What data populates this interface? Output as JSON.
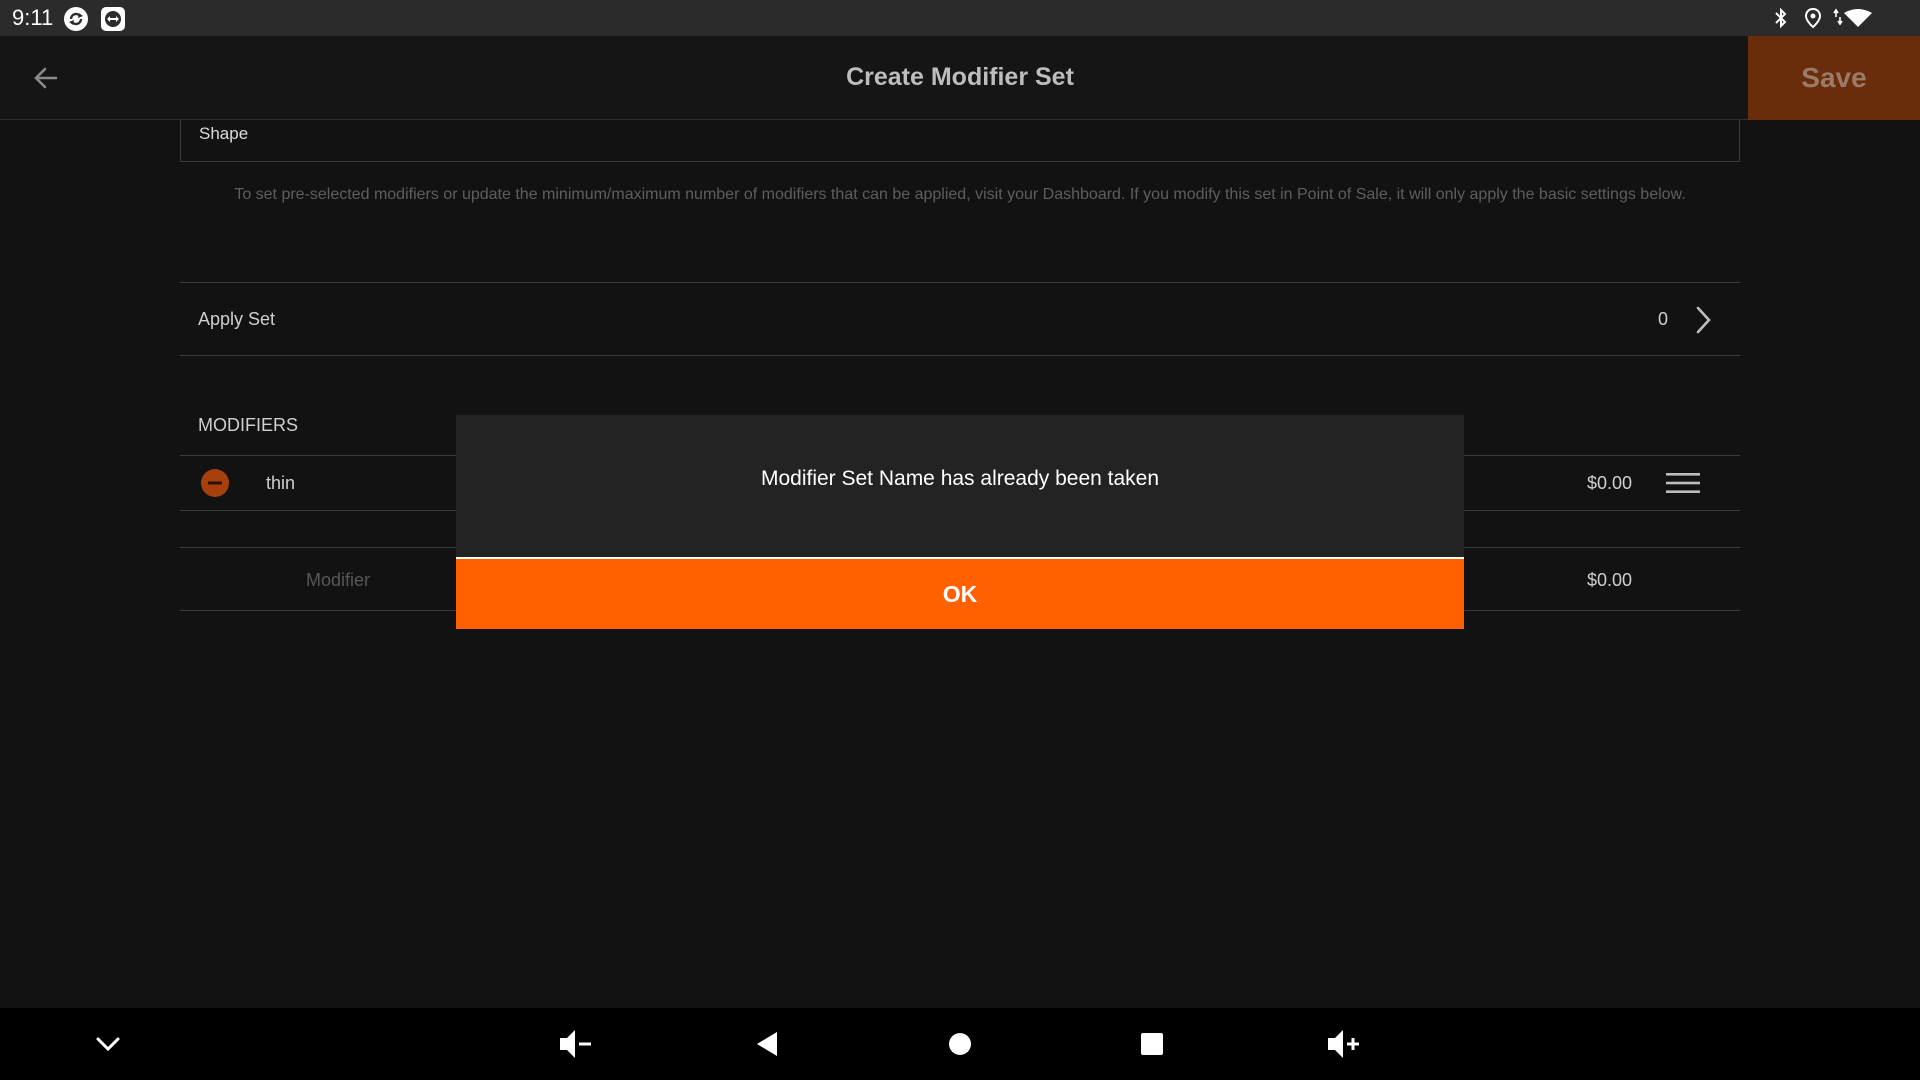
{
  "status_bar": {
    "time": "9:11",
    "left_icons": [
      "sync-icon",
      "teamviewer-icon"
    ],
    "right_icons": [
      "bluetooth-icon",
      "location-icon",
      "wifi-icon"
    ]
  },
  "app_bar": {
    "title": "Create Modifier Set",
    "save_label": "Save",
    "back_icon": "arrow-back-icon"
  },
  "form": {
    "shape_label": "Shape",
    "help_text": "To set pre-selected modifiers or update the minimum/maximum number of modifiers that can be applied, visit your Dashboard. If you modify this set in Point of Sale, it will only apply the basic settings below.",
    "apply_set": {
      "label": "Apply Set",
      "count": "0"
    },
    "modifiers_header": "MODIFIERS",
    "modifiers": [
      {
        "name": "thin",
        "price": "$0.00"
      }
    ],
    "new_modifier": {
      "placeholder": "Modifier",
      "price": "$0.00"
    }
  },
  "dialog": {
    "message": "Modifier Set Name has already been taken",
    "ok_label": "OK"
  },
  "colors": {
    "accent": "#ff6000",
    "save_button_dimmed": "#6a2d0c",
    "background": "#121212"
  },
  "nav_bar": {
    "icons": [
      "chevron-down-icon",
      "volume-down-icon",
      "back-triangle-icon",
      "home-circle-icon",
      "recents-square-icon",
      "volume-up-icon"
    ]
  }
}
